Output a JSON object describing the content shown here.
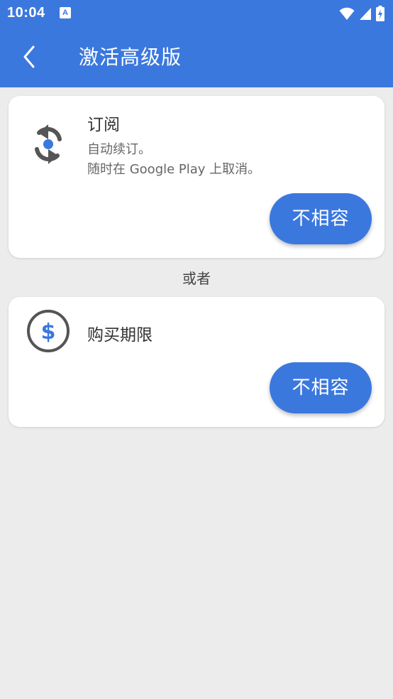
{
  "status_bar": {
    "time": "10:04",
    "app_icon_glyph": "A",
    "icons": [
      "wifi-icon",
      "signal-icon",
      "battery-charging-icon"
    ]
  },
  "toolbar": {
    "title": "激活高级版",
    "back_icon": "back-arrow-icon"
  },
  "options": {
    "subscription": {
      "icon": "sync-icon",
      "title": "订阅",
      "desc_line1": "自动续订。",
      "desc_line2": "随时在 Google Play 上取消。",
      "button_label": "不相容"
    },
    "separator": "或者",
    "lifetime": {
      "icon": "dollar-icon",
      "title": "购买期限",
      "button_label": "不相容"
    }
  },
  "colors": {
    "primary": "#3b78de",
    "background": "#ececec",
    "card": "#ffffff",
    "icon_gray": "#555555"
  }
}
